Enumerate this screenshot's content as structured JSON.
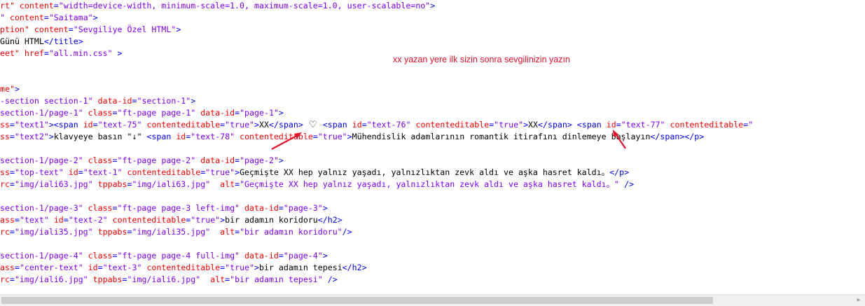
{
  "annotation": {
    "note": "xx yazan yere ilk sizin sonra sevgilinizin yazın",
    "color": "#e8102a"
  },
  "colors": {
    "tag": "#0000ff",
    "attr": "#ff0000",
    "value": "#8000ff",
    "text": "#000000"
  },
  "lines": [
    [
      {
        "t": "attr",
        "v": "rt\" "
      },
      {
        "t": "attr",
        "v": "content"
      },
      {
        "t": "tag",
        "v": "="
      },
      {
        "t": "val",
        "v": "\"width=device-width, minimum-scale=1.0, maximum-scale=1.0, user-scalable=no\""
      },
      {
        "t": "tag",
        "v": ">"
      }
    ],
    [
      {
        "t": "val",
        "v": "\" "
      },
      {
        "t": "attr",
        "v": "content"
      },
      {
        "t": "tag",
        "v": "="
      },
      {
        "t": "val",
        "v": "\"Saitama\""
      },
      {
        "t": "tag",
        "v": ">"
      }
    ],
    [
      {
        "t": "attr",
        "v": "ption\" "
      },
      {
        "t": "attr",
        "v": "content"
      },
      {
        "t": "tag",
        "v": "="
      },
      {
        "t": "val",
        "v": "\"Sevgiliye Özel HTML\""
      },
      {
        "t": "tag",
        "v": ">"
      }
    ],
    [
      {
        "t": "txt",
        "v": "Günü HTML"
      },
      {
        "t": "tag",
        "v": "</title>"
      }
    ],
    [
      {
        "t": "attr",
        "v": "eet\" "
      },
      {
        "t": "attr",
        "v": "href"
      },
      {
        "t": "tag",
        "v": "="
      },
      {
        "t": "val",
        "v": "\"all.min.css\""
      },
      {
        "t": "tag",
        "v": " >"
      }
    ],
    [],
    [],
    [
      {
        "t": "attr",
        "v": "me\""
      },
      {
        "t": "tag",
        "v": ">"
      }
    ],
    [
      {
        "t": "val",
        "v": "-section section-1\" "
      },
      {
        "t": "attr",
        "v": "data-id"
      },
      {
        "t": "tag",
        "v": "="
      },
      {
        "t": "val",
        "v": "\"section-1\""
      },
      {
        "t": "tag",
        "v": ">"
      }
    ],
    [
      {
        "t": "val",
        "v": "section-1/page-1\" "
      },
      {
        "t": "attr",
        "v": "class"
      },
      {
        "t": "tag",
        "v": "="
      },
      {
        "t": "val",
        "v": "\"ft-page page-1\" "
      },
      {
        "t": "attr",
        "v": "data-id"
      },
      {
        "t": "tag",
        "v": "="
      },
      {
        "t": "val",
        "v": "\"page-1\""
      },
      {
        "t": "tag",
        "v": ">"
      }
    ],
    [
      {
        "t": "attr",
        "v": "ss"
      },
      {
        "t": "tag",
        "v": "="
      },
      {
        "t": "val",
        "v": "\"text1\""
      },
      {
        "t": "tag",
        "v": "><span "
      },
      {
        "t": "attr",
        "v": "id"
      },
      {
        "t": "tag",
        "v": "="
      },
      {
        "t": "val",
        "v": "\"text-75\" "
      },
      {
        "t": "attr",
        "v": "contenteditable"
      },
      {
        "t": "tag",
        "v": "="
      },
      {
        "t": "val",
        "v": "\"true\""
      },
      {
        "t": "tag",
        "v": ">"
      },
      {
        "t": "txt",
        "v": "XX"
      },
      {
        "t": "tag",
        "v": "</span> "
      },
      {
        "t": "heart",
        "v": "♡"
      },
      {
        "t": "txt",
        "v": " "
      },
      {
        "t": "tag",
        "v": "<span "
      },
      {
        "t": "attr",
        "v": "id"
      },
      {
        "t": "tag",
        "v": "="
      },
      {
        "t": "val",
        "v": "\"text-76\" "
      },
      {
        "t": "attr",
        "v": "contenteditable"
      },
      {
        "t": "tag",
        "v": "="
      },
      {
        "t": "val",
        "v": "\"true\""
      },
      {
        "t": "tag",
        "v": ">"
      },
      {
        "t": "txt",
        "v": "XX"
      },
      {
        "t": "tag",
        "v": "</span> <span "
      },
      {
        "t": "attr",
        "v": "id"
      },
      {
        "t": "tag",
        "v": "="
      },
      {
        "t": "val",
        "v": "\"text-77\" "
      },
      {
        "t": "attr",
        "v": "contenteditable"
      },
      {
        "t": "tag",
        "v": "="
      },
      {
        "t": "val",
        "v": "\""
      }
    ],
    [
      {
        "t": "attr",
        "v": "ss"
      },
      {
        "t": "tag",
        "v": "="
      },
      {
        "t": "val",
        "v": "\"text2\""
      },
      {
        "t": "tag",
        "v": ">"
      },
      {
        "t": "txt",
        "v": "klavyeye basın \"↓\" "
      },
      {
        "t": "tag",
        "v": "<span "
      },
      {
        "t": "attr",
        "v": "id"
      },
      {
        "t": "tag",
        "v": "="
      },
      {
        "t": "val",
        "v": "\"text-78\" "
      },
      {
        "t": "attr",
        "v": "contenteditable"
      },
      {
        "t": "tag",
        "v": "="
      },
      {
        "t": "val",
        "v": "\"true\""
      },
      {
        "t": "tag",
        "v": ">"
      },
      {
        "t": "txt",
        "v": "Mühendislik adamlarının romantik itirafını dinlemeye başlayın"
      },
      {
        "t": "tag",
        "v": "</span></p>"
      }
    ],
    [],
    [
      {
        "t": "val",
        "v": "section-1/page-2\" "
      },
      {
        "t": "attr",
        "v": "class"
      },
      {
        "t": "tag",
        "v": "="
      },
      {
        "t": "val",
        "v": "\"ft-page page-2\" "
      },
      {
        "t": "attr",
        "v": "data-id"
      },
      {
        "t": "tag",
        "v": "="
      },
      {
        "t": "val",
        "v": "\"page-2\""
      },
      {
        "t": "tag",
        "v": ">"
      }
    ],
    [
      {
        "t": "attr",
        "v": "ss"
      },
      {
        "t": "tag",
        "v": "="
      },
      {
        "t": "val",
        "v": "\"top-text\" "
      },
      {
        "t": "attr",
        "v": "id"
      },
      {
        "t": "tag",
        "v": "="
      },
      {
        "t": "val",
        "v": "\"text-1\" "
      },
      {
        "t": "attr",
        "v": "contenteditable"
      },
      {
        "t": "tag",
        "v": "="
      },
      {
        "t": "val",
        "v": "\"true\""
      },
      {
        "t": "tag",
        "v": ">"
      },
      {
        "t": "txt",
        "v": "Geçmişte XX hep yalnız yaşadı, yalnızlıktan zevk aldı ve aşka hasret kaldı。"
      },
      {
        "t": "tag",
        "v": "</p>"
      }
    ],
    [
      {
        "t": "attr",
        "v": "rc"
      },
      {
        "t": "tag",
        "v": "="
      },
      {
        "t": "val",
        "v": "\"img/iali63.jpg\" "
      },
      {
        "t": "attr",
        "v": "tppabs"
      },
      {
        "t": "tag",
        "v": "="
      },
      {
        "t": "val",
        "v": "\"img/iali63.jpg\"  "
      },
      {
        "t": "attr",
        "v": "alt"
      },
      {
        "t": "tag",
        "v": "="
      },
      {
        "t": "val",
        "v": "\"Geçmişte XX hep yalnız yaşadı, yalnızlıktan zevk aldı ve aşka hasret kaldı。\""
      },
      {
        "t": "tag",
        "v": " />"
      }
    ],
    [],
    [
      {
        "t": "val",
        "v": "section-1/page-3\" "
      },
      {
        "t": "attr",
        "v": "class"
      },
      {
        "t": "tag",
        "v": "="
      },
      {
        "t": "val",
        "v": "\"ft-page page-3 left-img\" "
      },
      {
        "t": "attr",
        "v": "data-id"
      },
      {
        "t": "tag",
        "v": "="
      },
      {
        "t": "val",
        "v": "\"page-3\""
      },
      {
        "t": "tag",
        "v": ">"
      }
    ],
    [
      {
        "t": "attr",
        "v": "ass"
      },
      {
        "t": "tag",
        "v": "="
      },
      {
        "t": "val",
        "v": "\"text\" "
      },
      {
        "t": "attr",
        "v": "id"
      },
      {
        "t": "tag",
        "v": "="
      },
      {
        "t": "val",
        "v": "\"text-2\" "
      },
      {
        "t": "attr",
        "v": "contenteditable"
      },
      {
        "t": "tag",
        "v": "="
      },
      {
        "t": "val",
        "v": "\"true\""
      },
      {
        "t": "tag",
        "v": ">"
      },
      {
        "t": "txt",
        "v": "bir adamın koridoru"
      },
      {
        "t": "tag",
        "v": "</h2>"
      }
    ],
    [
      {
        "t": "attr",
        "v": "rc"
      },
      {
        "t": "tag",
        "v": "="
      },
      {
        "t": "val",
        "v": "\"img/iali35.jpg\" "
      },
      {
        "t": "attr",
        "v": "tppabs"
      },
      {
        "t": "tag",
        "v": "="
      },
      {
        "t": "val",
        "v": "\"img/iali35.jpg\"  "
      },
      {
        "t": "attr",
        "v": "alt"
      },
      {
        "t": "tag",
        "v": "="
      },
      {
        "t": "val",
        "v": "\"bir adamın koridoru\""
      },
      {
        "t": "tag",
        "v": "/>"
      }
    ],
    [],
    [
      {
        "t": "val",
        "v": "section-1/page-4\" "
      },
      {
        "t": "attr",
        "v": "class"
      },
      {
        "t": "tag",
        "v": "="
      },
      {
        "t": "val",
        "v": "\"ft-page page-4 full-img\" "
      },
      {
        "t": "attr",
        "v": "data-id"
      },
      {
        "t": "tag",
        "v": "="
      },
      {
        "t": "val",
        "v": "\"page-4\""
      },
      {
        "t": "tag",
        "v": ">"
      }
    ],
    [
      {
        "t": "attr",
        "v": "ass"
      },
      {
        "t": "tag",
        "v": "="
      },
      {
        "t": "val",
        "v": "\"center-text\" "
      },
      {
        "t": "attr",
        "v": "id"
      },
      {
        "t": "tag",
        "v": "="
      },
      {
        "t": "val",
        "v": "\"text-3\" "
      },
      {
        "t": "attr",
        "v": "contenteditable"
      },
      {
        "t": "tag",
        "v": "="
      },
      {
        "t": "val",
        "v": "\"true\""
      },
      {
        "t": "tag",
        "v": ">"
      },
      {
        "t": "txt",
        "v": "bir adamın tepesi"
      },
      {
        "t": "tag",
        "v": "</h2>"
      }
    ],
    [
      {
        "t": "attr",
        "v": "rc"
      },
      {
        "t": "tag",
        "v": "="
      },
      {
        "t": "val",
        "v": "\"img/iali6.jpg\" "
      },
      {
        "t": "attr",
        "v": "tppabs"
      },
      {
        "t": "tag",
        "v": "="
      },
      {
        "t": "val",
        "v": "\"img/iali6.jpg\"  "
      },
      {
        "t": "attr",
        "v": "alt"
      },
      {
        "t": "tag",
        "v": "="
      },
      {
        "t": "val",
        "v": "\"bir adamın tepesi\""
      },
      {
        "t": "tag",
        "v": " />"
      }
    ]
  ],
  "scrollbar": {
    "right_arrow": "▸"
  }
}
